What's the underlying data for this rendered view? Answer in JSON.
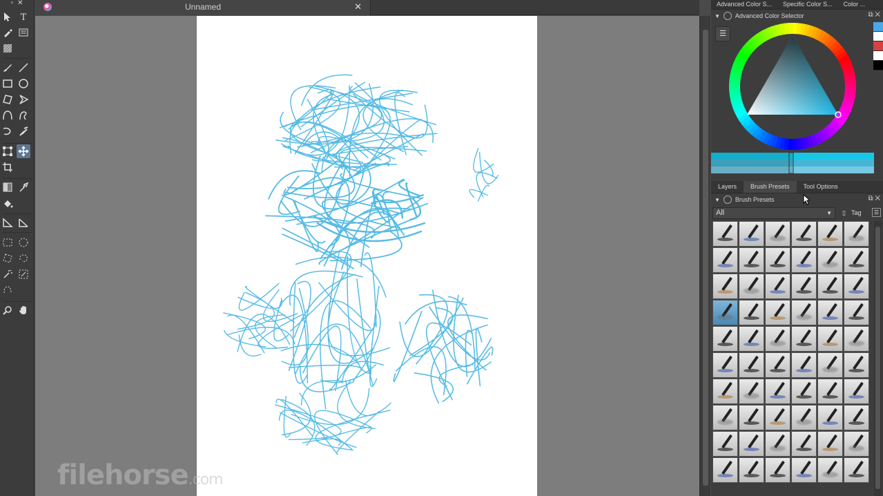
{
  "document": {
    "title": "Unnamed"
  },
  "toolbox": {
    "tools": [
      {
        "icon": "select-shapes-icon",
        "active": false
      },
      {
        "icon": "text-tool-icon",
        "active": false
      },
      {
        "icon": "edit-shapes-icon",
        "active": false
      },
      {
        "icon": "calligraphy-icon",
        "active": false
      },
      {
        "icon": "pattern-icon",
        "active": false
      },
      {
        "icon": "freehand-brush-icon",
        "active": false
      },
      {
        "icon": "line-tool-icon",
        "active": false
      },
      {
        "icon": "rectangle-tool-icon",
        "active": false
      },
      {
        "icon": "ellipse-tool-icon",
        "active": false
      },
      {
        "icon": "polygon-tool-icon",
        "active": false
      },
      {
        "icon": "polyline-tool-icon",
        "active": false
      },
      {
        "icon": "bezier-curve-icon",
        "active": false
      },
      {
        "icon": "freehand-path-icon",
        "active": false
      },
      {
        "icon": "dynamic-brush-icon",
        "active": false
      },
      {
        "icon": "multibrush-icon",
        "active": false
      },
      {
        "icon": "transform-tool-icon",
        "active": false
      },
      {
        "icon": "move-tool-icon",
        "active": true
      },
      {
        "icon": "crop-tool-icon",
        "active": false
      },
      {
        "icon": "gradient-tool-icon",
        "active": false
      },
      {
        "icon": "color-picker-icon",
        "active": false
      },
      {
        "icon": "fill-tool-icon",
        "active": false
      },
      {
        "icon": "assistant-tool-icon",
        "active": false
      },
      {
        "icon": "measure-tool-icon",
        "active": false
      },
      {
        "icon": "rect-select-icon",
        "active": false
      },
      {
        "icon": "ellipse-select-icon",
        "active": false
      },
      {
        "icon": "polygon-select-icon",
        "active": false
      },
      {
        "icon": "freehand-select-icon",
        "active": false
      },
      {
        "icon": "contiguous-select-icon",
        "active": false
      },
      {
        "icon": "similar-select-icon",
        "active": false
      },
      {
        "icon": "bezier-select-icon",
        "active": false
      },
      {
        "icon": "zoom-tool-icon",
        "active": false
      },
      {
        "icon": "pan-tool-icon",
        "active": false
      }
    ]
  },
  "dock": {
    "top_tabs": [
      "Advanced Color S...",
      "Specific Color S...",
      "Color ..."
    ],
    "color_selector": {
      "title": "Advanced Color Selector",
      "swatches": [
        "#4aa8e8",
        "#ffffff",
        "#d94040",
        "#ffffff",
        "#000000"
      ]
    },
    "panel_tabs": [
      {
        "label": "Layers",
        "active": false
      },
      {
        "label": "Brush Presets",
        "active": true
      },
      {
        "label": "Tool Options",
        "active": false
      }
    ],
    "brush_presets": {
      "title": "Brush Presets",
      "filter_value": "All",
      "tag_label": "Tag",
      "preset_count": 60
    }
  },
  "watermark": {
    "main": "filehorse",
    "suffix": ".com"
  },
  "colors": {
    "sketch": "#3ab0e0",
    "canvas_bg": "#7d7d7d",
    "paper": "#ffffff",
    "active_tool": "#5c7690"
  }
}
